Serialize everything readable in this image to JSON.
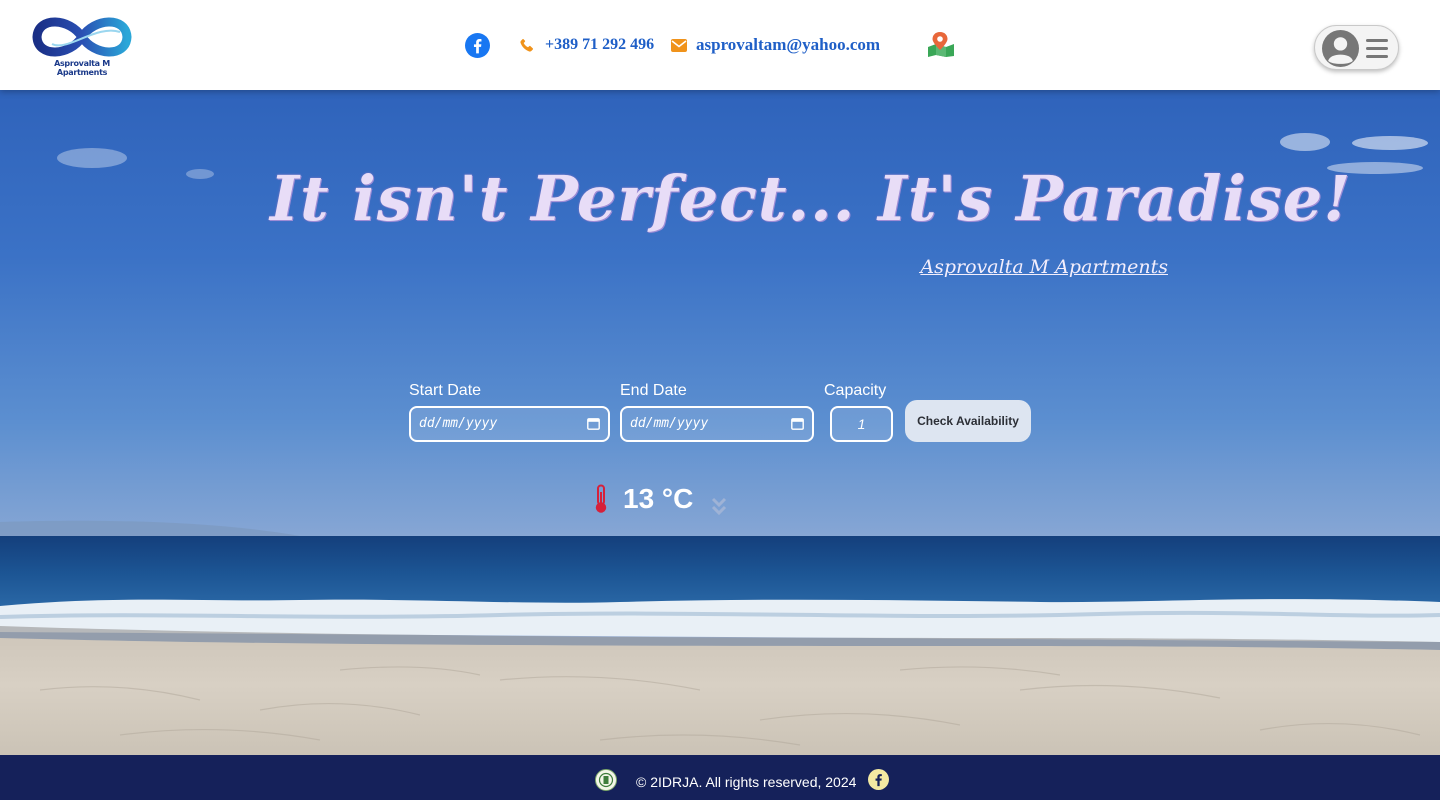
{
  "brand": {
    "logo_text": "Asprovalta M Apartments"
  },
  "header": {
    "phone": "+389 71 292 496",
    "email": "asprovaltam@yahoo.com",
    "icons": [
      "facebook-icon",
      "phone-icon",
      "envelope-icon",
      "map-pin-icon",
      "user-icon",
      "bars-icon"
    ]
  },
  "hero": {
    "headline": "It isn't Perfect... It's Paradise!",
    "subline": "Asprovalta M Apartments"
  },
  "booking": {
    "start_label": "Start Date",
    "start_placeholder": "dd/mm/yyyy",
    "end_label": "End Date",
    "end_placeholder": "dd/mm/yyyy",
    "capacity_label": "Capacity",
    "capacity_value": "1",
    "check_button": "Check Availability"
  },
  "weather": {
    "temperature": "13 °C"
  },
  "footer": {
    "copyright": "© 2IDRJA. All rights reserved, 2024"
  },
  "colors": {
    "link_blue": "#1f5fc7",
    "accent_orange": "#f0931b",
    "footer_bg": "#15215a",
    "thermo_red": "#d6203a"
  }
}
